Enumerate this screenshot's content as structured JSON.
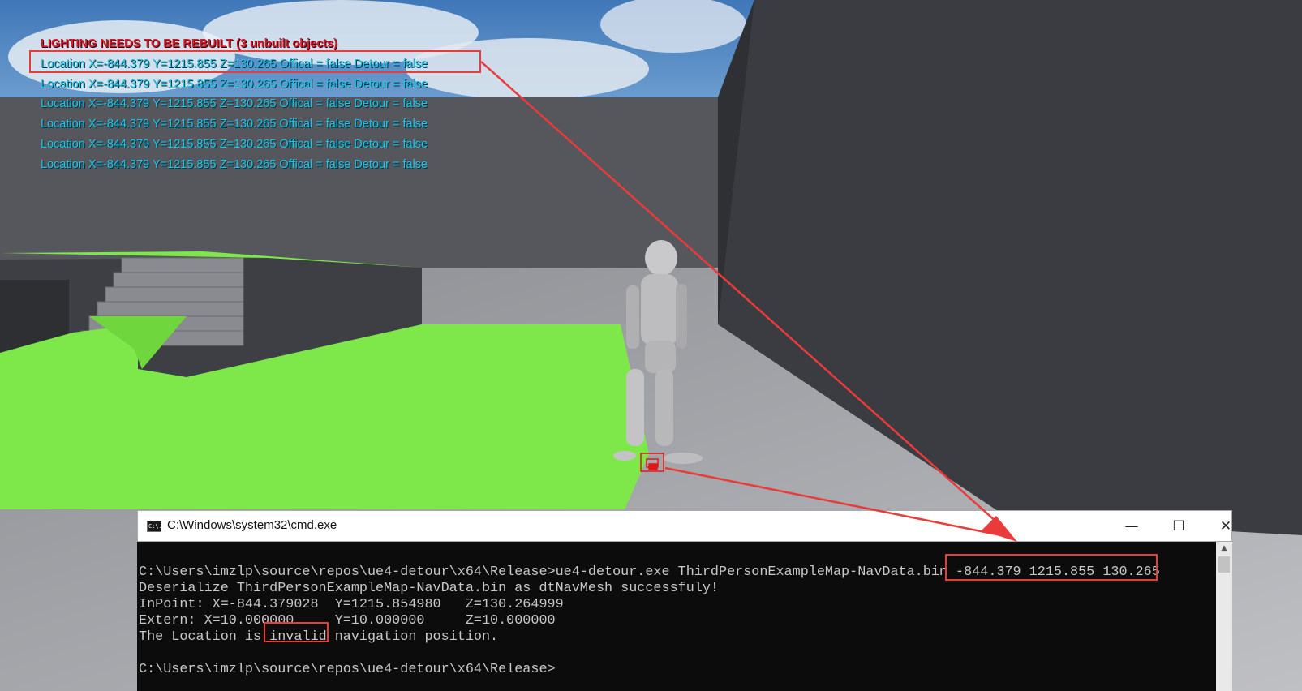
{
  "viewport": {
    "warning_text": "LIGHTING NEEDS TO BE REBUILT (3 unbuilt objects)",
    "log_lines": [
      "Location X=-844.379 Y=1215.855 Z=130.265 Offical = false Detour = false",
      "Location X=-844.379 Y=1215.855 Z=130.265 Offical = false Detour = false",
      "Location X=-844.379 Y=1215.855 Z=130.265 Offical = false Detour = false",
      "Location X=-844.379 Y=1215.855 Z=130.265 Offical = false Detour = false",
      "Location X=-844.379 Y=1215.855 Z=130.265 Offical = false Detour = false",
      "Location X=-844.379 Y=1215.855 Z=130.265 Offical = false Detour = false"
    ]
  },
  "console": {
    "title": "C:\\Windows\\system32\\cmd.exe",
    "icon": "cmd-icon",
    "icon_text": "C:\\.",
    "buttons": {
      "minimize": "—",
      "maximize": "☐",
      "close": "✕"
    },
    "lines": {
      "command_prefix": "C:\\Users\\imzlp\\source\\repos\\ue4-detour\\x64\\Release>ue4-detour.exe ThirdPersonExampleMap-NavData.bin ",
      "command_args": "-844.379 1215.855 130.265",
      "deserialize": "Deserialize ThirdPersonExampleMap-NavData.bin as dtNavMesh successfuly!",
      "inpoint": "InPoint: X=-844.379028  Y=1215.854980   Z=130.264999",
      "extern": "Extern: X=10.000000     Y=10.000000     Z=10.000000",
      "result_prefix": "The Location is ",
      "result_word": "invalid",
      "result_suffix": " navigation position.",
      "prompt": "C:\\Users\\imzlp\\source\\repos\\ue4-detour\\x64\\Release>"
    }
  },
  "colors": {
    "warning_red": "#d8182a",
    "log_cyan": "#1ec3e8",
    "annotation_red": "#ea3a3a",
    "navmesh_green": "#7ee84a",
    "console_bg": "#0c0c0c",
    "console_text": "#c8c8c8"
  }
}
